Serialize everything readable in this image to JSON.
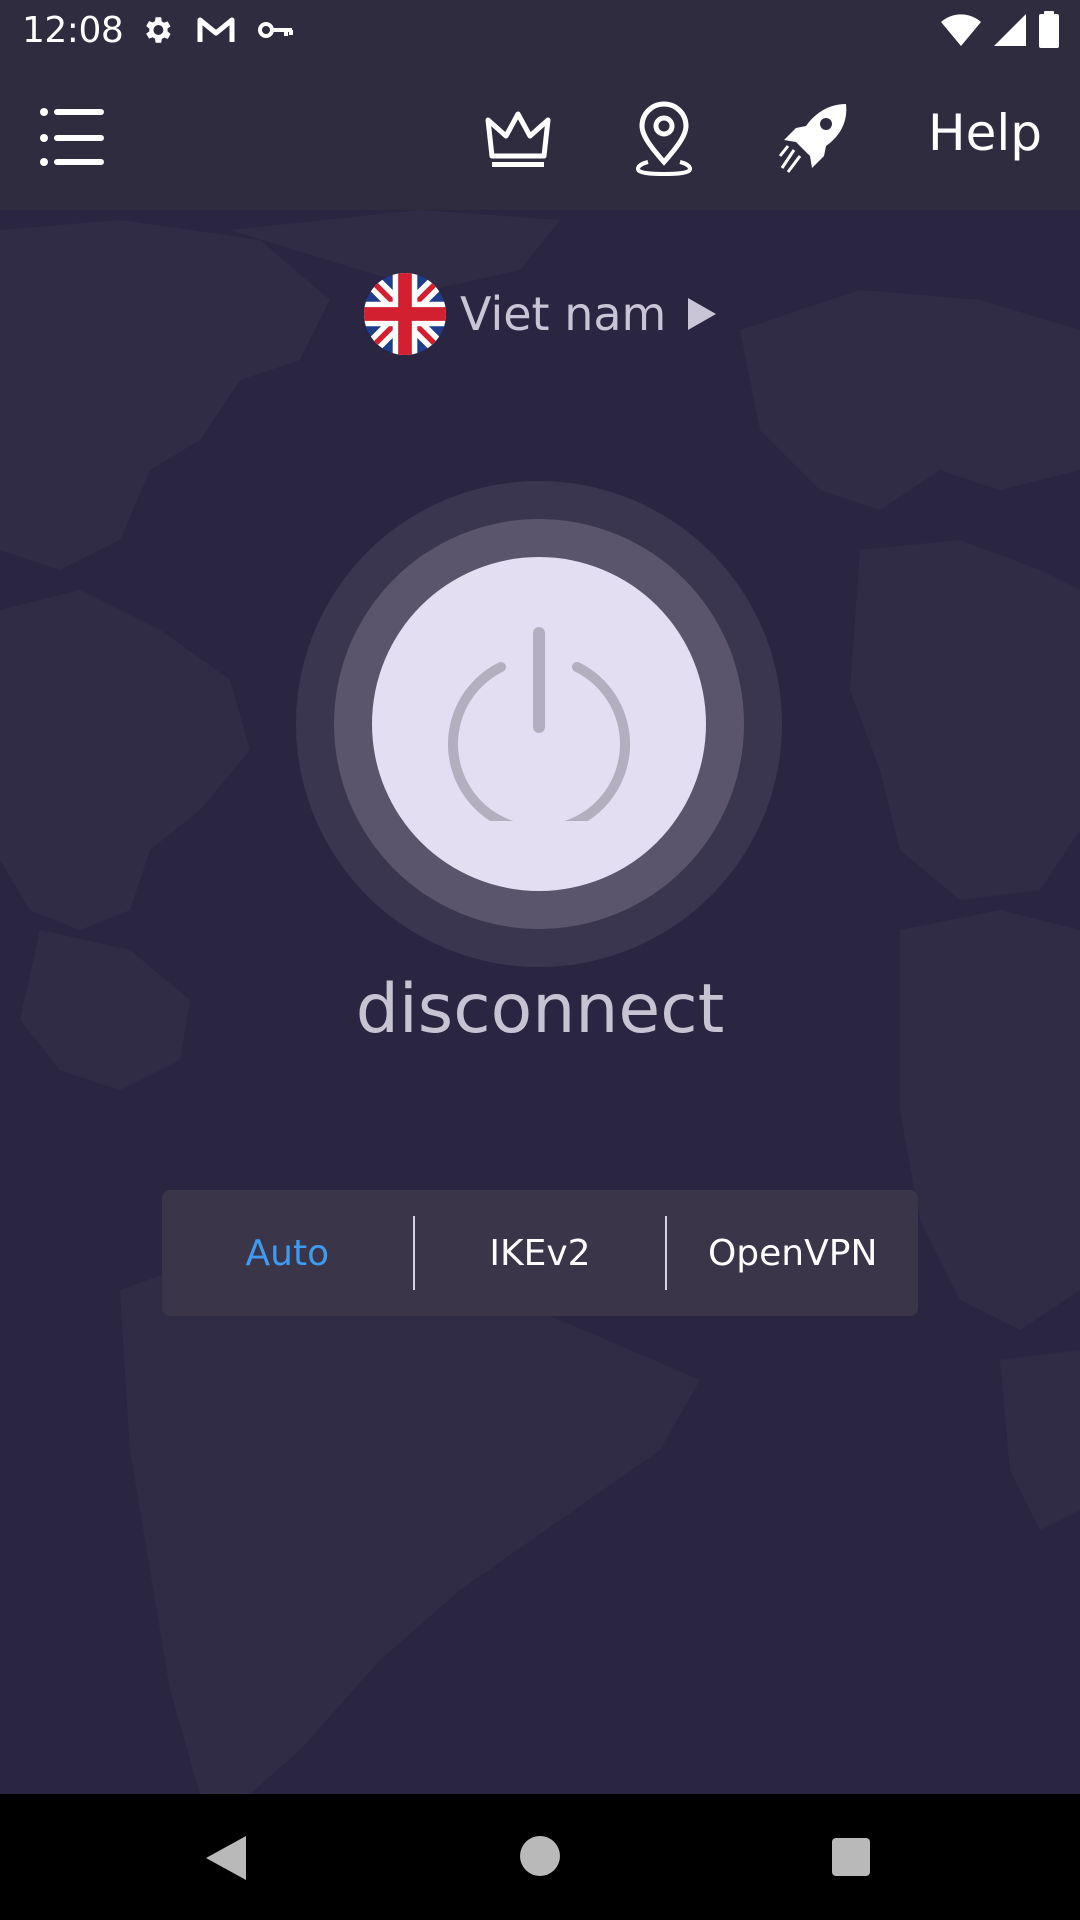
{
  "status_bar": {
    "time": "12:08",
    "left_icons": [
      "settings-icon",
      "gmail-icon",
      "vpn-key-icon"
    ],
    "right_icons": [
      "wifi-icon",
      "signal-icon",
      "battery-icon"
    ]
  },
  "app_bar": {
    "icons": [
      "menu-icon",
      "crown-icon",
      "location-pin-icon",
      "rocket-icon"
    ],
    "help_label": "Help"
  },
  "location": {
    "flag": "uk-flag-icon",
    "name": "Viet nam"
  },
  "connection": {
    "status": "disconnect"
  },
  "protocols": {
    "options": [
      "Auto",
      "IKEv2",
      "OpenVPN"
    ],
    "selected": "Auto"
  },
  "colors": {
    "background": "#2a2540",
    "accent": "#3f9bf0",
    "power_button": "#e3def2"
  }
}
